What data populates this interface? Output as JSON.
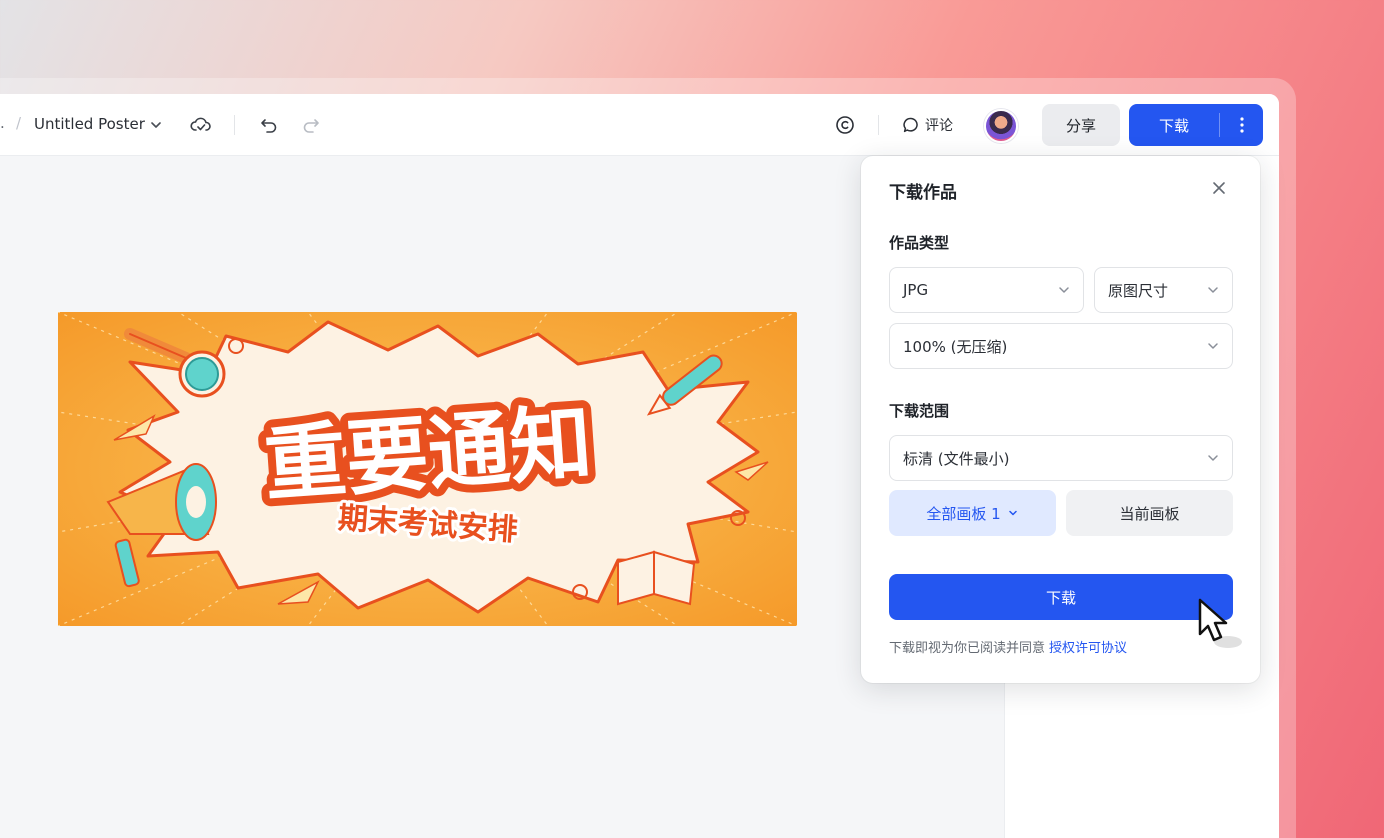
{
  "toolbar": {
    "breadcrumb_prefix": ".",
    "breadcrumb_sep": "/",
    "doc_title": "Untitled Poster",
    "comment_label": "评论",
    "share_label": "分享",
    "download_label": "下载"
  },
  "poster": {
    "headline": "重要通知",
    "subline": "期末考试安排",
    "colors": {
      "bg": "#f7a634",
      "burst": "#fdf1e2",
      "headline": "#e8501f",
      "accent": "#4ecbc4"
    }
  },
  "popup": {
    "title": "下载作品",
    "type_section": "作品类型",
    "format_value": "JPG",
    "size_value": "原图尺寸",
    "quality_value": "100% (无压缩)",
    "scope_section": "下载范围",
    "resolution_value": "标清 (文件最小)",
    "scope_all": "全部画板 1",
    "scope_current": "当前画板",
    "download_button": "下载",
    "agreement_text": "下载即视为你已阅读并同意",
    "agreement_link": "授权许可协议"
  },
  "icons": {
    "title_chevron": "chevron-down-icon",
    "cloud": "cloud-sync-icon",
    "undo": "undo-icon",
    "redo": "redo-icon",
    "copyright": "copyright-icon",
    "comment": "comment-icon",
    "more": "more-vertical-icon",
    "close": "close-icon",
    "cursor": "mouse-pointer-icon"
  },
  "colors": {
    "primary": "#2456f0",
    "primary_light": "#e0e9ff",
    "text": "#1f2329"
  }
}
